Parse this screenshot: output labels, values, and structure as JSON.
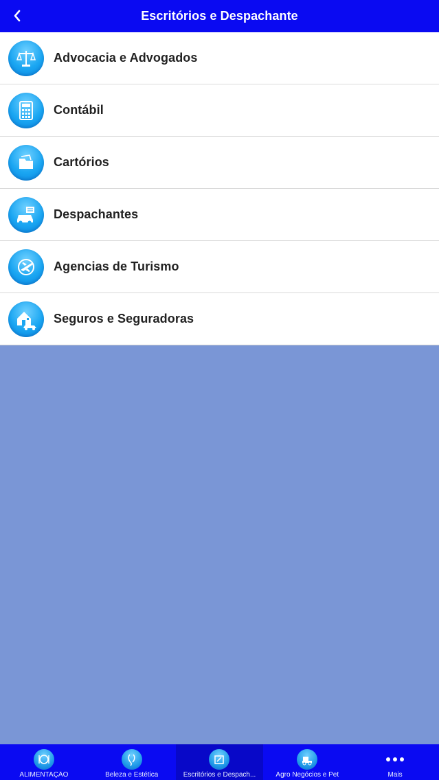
{
  "navbar": {
    "title": "Escritórios e Despachante",
    "back_icon": "chevron-left-icon"
  },
  "list": {
    "items": [
      {
        "label": "Advocacia e Advogados",
        "icon": "scales-icon"
      },
      {
        "label": "Contábil",
        "icon": "calculator-icon"
      },
      {
        "label": "Cartórios",
        "icon": "folder-icon"
      },
      {
        "label": "Despachantes",
        "icon": "car-document-icon"
      },
      {
        "label": "Agencias de Turismo",
        "icon": "globe-plane-icon"
      },
      {
        "label": "Seguros e Seguradoras",
        "icon": "house-car-icon"
      }
    ]
  },
  "tabbar": {
    "tabs": [
      {
        "label": "ALIMENTAÇÃO",
        "icon": "plate-icon",
        "active": false
      },
      {
        "label": "Beleza e Estética",
        "icon": "face-icon",
        "active": false
      },
      {
        "label": "Escritórios e Despach...",
        "icon": "office-icon",
        "active": true
      },
      {
        "label": "Agro Negócios e Pet",
        "icon": "tractor-icon",
        "active": false
      },
      {
        "label": "Mais",
        "icon": "more-dots-icon",
        "active": false
      }
    ]
  },
  "colors": {
    "bar": "#0a0af2",
    "background": "#7a96d6",
    "icon_blue": "#1aa6f2"
  }
}
